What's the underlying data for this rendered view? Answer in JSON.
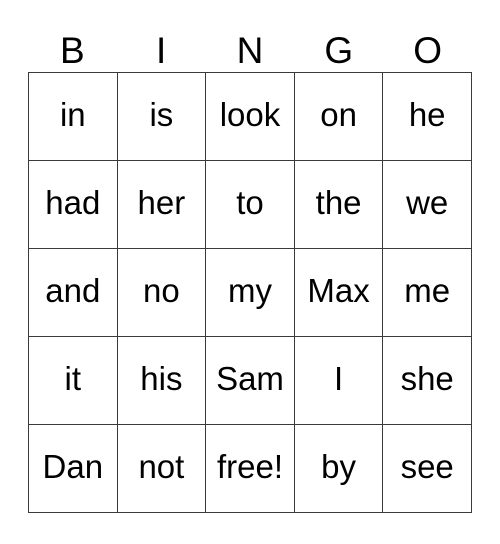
{
  "card": {
    "header_letters": [
      "B",
      "I",
      "N",
      "G",
      "O"
    ],
    "background_color": "#ffffff",
    "border_color": "#3a3a3a",
    "text_color": "#000000",
    "rows": [
      [
        "in",
        "is",
        "look",
        "on",
        "he"
      ],
      [
        "had",
        "her",
        "to",
        "the",
        "we"
      ],
      [
        "and",
        "no",
        "my",
        "Max",
        "me"
      ],
      [
        "it",
        "his",
        "Sam",
        "I",
        "she"
      ],
      [
        "Dan",
        "not",
        "free!",
        "by",
        "see"
      ]
    ]
  }
}
